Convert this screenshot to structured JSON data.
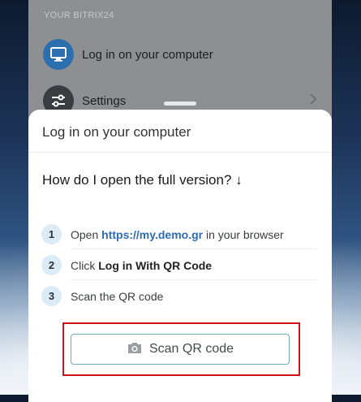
{
  "menu": {
    "section_label": "YOUR BITRIX24",
    "items": [
      {
        "label": "Log in on your computer",
        "icon": "monitor-icon"
      },
      {
        "label": "Settings",
        "icon": "sliders-icon"
      }
    ]
  },
  "sheet": {
    "title": "Log in on your computer",
    "question": "How do I open the full version? ↓",
    "steps": [
      {
        "number": "1",
        "text_before": "Open ",
        "link": "https://my.demo.gr",
        "text_after": " in your browser"
      },
      {
        "number": "2",
        "text_before": "Click ",
        "bold": "Log in With QR Code"
      },
      {
        "number": "3",
        "text": "Scan the QR code"
      }
    ],
    "scan_button": {
      "label": "Scan QR code",
      "icon": "camera-icon"
    }
  },
  "colors": {
    "accent_link": "#2f6bb5",
    "highlight": "#d0121b",
    "button_border": "#6fb0b6",
    "step_badge": "#dcecf7"
  }
}
